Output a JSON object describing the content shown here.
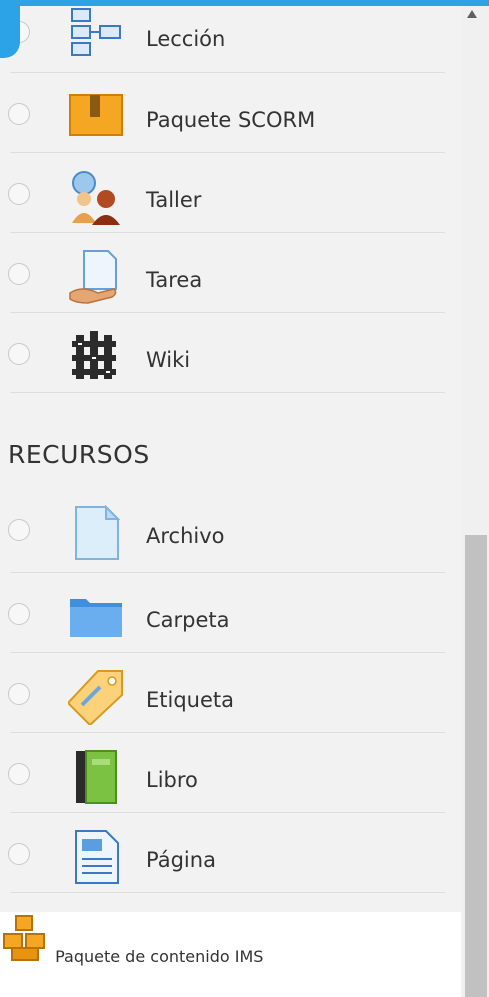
{
  "activities": [
    {
      "label": "Lección",
      "icon": "lesson-icon",
      "selected": false
    },
    {
      "label": "Paquete SCORM",
      "icon": "scorm-package-icon",
      "selected": false
    },
    {
      "label": "Taller",
      "icon": "workshop-icon",
      "selected": false
    },
    {
      "label": "Tarea",
      "icon": "assignment-icon",
      "selected": false
    },
    {
      "label": "Wiki",
      "icon": "wiki-icon",
      "selected": false
    }
  ],
  "resources_heading": "RECURSOS",
  "resources": [
    {
      "label": "Archivo",
      "icon": "file-icon",
      "selected": false
    },
    {
      "label": "Carpeta",
      "icon": "folder-icon",
      "selected": false
    },
    {
      "label": "Etiqueta",
      "icon": "label-tag-icon",
      "selected": false
    },
    {
      "label": "Libro",
      "icon": "book-icon",
      "selected": false
    },
    {
      "label": "Página",
      "icon": "page-icon",
      "selected": false
    },
    {
      "label_line1": "Paquete de",
      "label_line2": "contenido IMS",
      "icon": "ims-package-icon",
      "selected": true
    }
  ],
  "colors": {
    "accent": "#2ba3e6",
    "selected_row": "#ffffff",
    "background": "#f2f2f2"
  }
}
